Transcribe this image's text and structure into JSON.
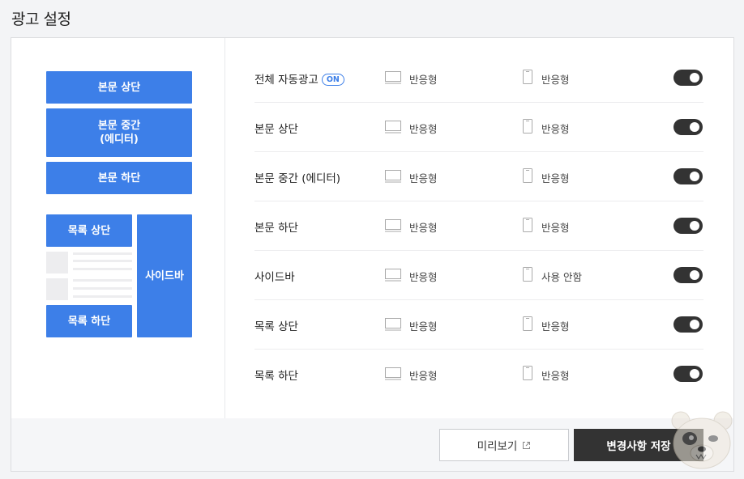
{
  "title": "광고 설정",
  "preview": {
    "body_top": "본문 상단",
    "body_middle_line1": "본문 중간",
    "body_middle_line2": "(에디터)",
    "body_bottom": "본문 하단",
    "list_top": "목록 상단",
    "list_bottom": "목록 하단",
    "sidebar": "사이드바"
  },
  "rows": [
    {
      "label": "전체 자동광고",
      "badge": "ON",
      "pc": "반응형",
      "mobile": "반응형",
      "enabled": true
    },
    {
      "label": "본문 상단",
      "pc": "반응형",
      "mobile": "반응형",
      "enabled": true
    },
    {
      "label": "본문 중간 (에디터)",
      "pc": "반응형",
      "mobile": "반응형",
      "enabled": true
    },
    {
      "label": "본문 하단",
      "pc": "반응형",
      "mobile": "반응형",
      "enabled": true
    },
    {
      "label": "사이드바",
      "pc": "반응형",
      "mobile": "사용 안함",
      "enabled": true
    },
    {
      "label": "목록 상단",
      "pc": "반응형",
      "mobile": "반응형",
      "enabled": true
    },
    {
      "label": "목록 하단",
      "pc": "반응형",
      "mobile": "반응형",
      "enabled": true
    }
  ],
  "buttons": {
    "preview": "미리보기",
    "save": "변경사항 저장"
  },
  "icons": {
    "pc": "monitor-icon",
    "mobile": "mobile-icon",
    "external": "external-link-icon",
    "mascot": "bear-mascot-icon"
  },
  "colors": {
    "accent": "#3d7fe8",
    "toggle_on": "#333333",
    "save_button": "#333333"
  }
}
